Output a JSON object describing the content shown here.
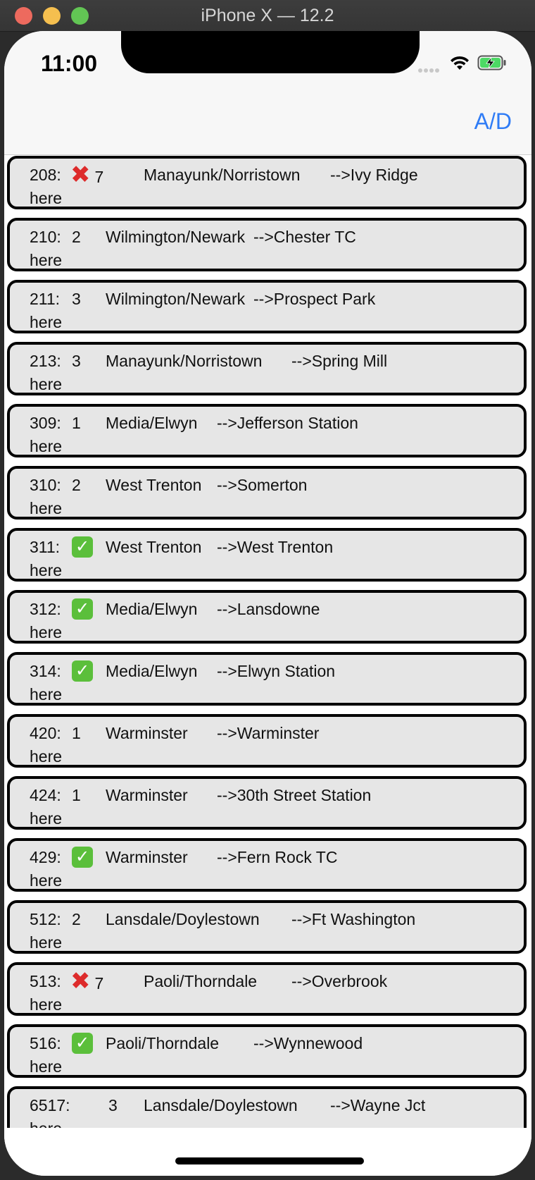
{
  "window": {
    "title": "iPhone X — 12.2"
  },
  "status_bar": {
    "time": "11:00"
  },
  "nav": {
    "right_button": "A/D"
  },
  "trains": [
    {
      "id": "208:",
      "status_kind": "cross",
      "status_text": "7",
      "line": "Manayunk/Norristown",
      "destination": "-->Ivy Ridge",
      "note": "here"
    },
    {
      "id": "210:",
      "status_kind": "number",
      "status_text": "2",
      "line": "Wilmington/Newark",
      "destination": "-->Chester TC",
      "note": "here"
    },
    {
      "id": "211:",
      "status_kind": "number",
      "status_text": "3",
      "line": "Wilmington/Newark",
      "destination": "-->Prospect Park",
      "note": "here"
    },
    {
      "id": "213:",
      "status_kind": "number",
      "status_text": "3",
      "line": "Manayunk/Norristown",
      "destination": "-->Spring Mill",
      "note": "here"
    },
    {
      "id": "309:",
      "status_kind": "number",
      "status_text": "1",
      "line": "Media/Elwyn",
      "destination": "-->Jefferson Station",
      "note": "here"
    },
    {
      "id": "310:",
      "status_kind": "number",
      "status_text": "2",
      "line": "West Trenton",
      "destination": "-->Somerton",
      "note": "here"
    },
    {
      "id": "311:",
      "status_kind": "check",
      "status_text": "",
      "line": "West Trenton",
      "destination": "-->West Trenton",
      "note": "here"
    },
    {
      "id": "312:",
      "status_kind": "check",
      "status_text": "",
      "line": "Media/Elwyn",
      "destination": "-->Lansdowne",
      "note": "here"
    },
    {
      "id": "314:",
      "status_kind": "check",
      "status_text": "",
      "line": "Media/Elwyn",
      "destination": "-->Elwyn Station",
      "note": "here"
    },
    {
      "id": "420:",
      "status_kind": "number",
      "status_text": "1",
      "line": "Warminster",
      "destination": "-->Warminster",
      "note": "here"
    },
    {
      "id": "424:",
      "status_kind": "number",
      "status_text": "1",
      "line": "Warminster",
      "destination": "-->30th Street Station",
      "note": "here"
    },
    {
      "id": "429:",
      "status_kind": "check",
      "status_text": "",
      "line": "Warminster",
      "destination": "-->Fern Rock TC",
      "note": "here"
    },
    {
      "id": "512:",
      "status_kind": "number",
      "status_text": "2",
      "line": "Lansdale/Doylestown",
      "destination": "-->Ft Washington",
      "note": "here"
    },
    {
      "id": "513:",
      "status_kind": "cross",
      "status_text": "7",
      "line": "Paoli/Thorndale",
      "destination": "-->Overbrook",
      "note": "here"
    },
    {
      "id": "516:",
      "status_kind": "check",
      "status_text": "",
      "line": "Paoli/Thorndale",
      "destination": "-->Wynnewood",
      "note": "here"
    },
    {
      "id": "6517:",
      "status_kind": "number",
      "status_text": "3",
      "line": "Lansdale/Doylestown",
      "destination": "-->Wayne Jct",
      "note": "here"
    }
  ],
  "colors": {
    "accent": "#2f7cf6",
    "row_bg": "#e6e6e6",
    "row_border": "#000000",
    "check": "#5bbf3b",
    "cross": "#dd2b2b"
  }
}
